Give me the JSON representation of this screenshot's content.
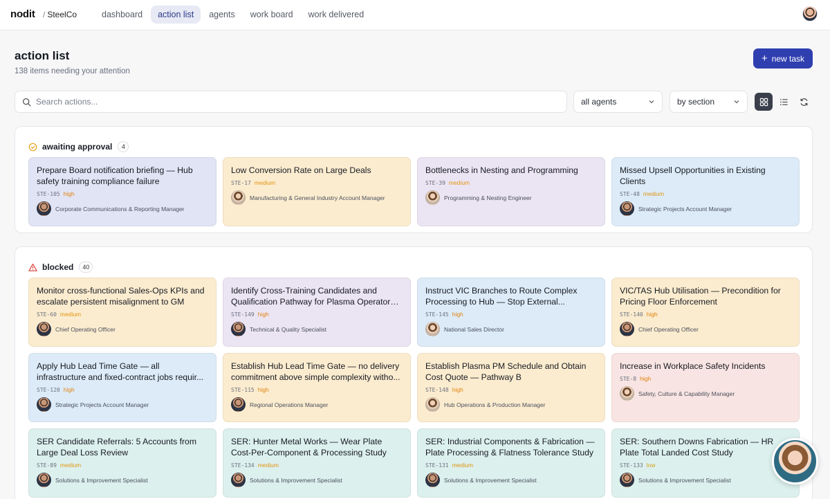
{
  "nav": {
    "brand": "nodit",
    "org": "SteelCo",
    "tabs": [
      {
        "label": "dashboard"
      },
      {
        "label": "action list"
      },
      {
        "label": "agents"
      },
      {
        "label": "work board"
      },
      {
        "label": "work delivered"
      }
    ],
    "active_tab": "action list"
  },
  "header": {
    "title": "action list",
    "subtitle": "138 items needing your attention",
    "new_task_label": "new task"
  },
  "toolbar": {
    "search_placeholder": "Search actions...",
    "agents_filter": "all agents",
    "group_by": "by section",
    "icons": [
      "grid-view-icon",
      "list-view-icon",
      "refresh-icon"
    ]
  },
  "sections": [
    {
      "title": "awaiting approval",
      "count": "4",
      "icon": "check-circle-icon",
      "cards": [
        {
          "title": "Prepare Board notification briefing — Hub safety training compliance failure",
          "id": "STE-105",
          "priority": "high",
          "owner": "Corporate Communications & Reporting Manager"
        },
        {
          "title": "Low Conversion Rate on Large Deals",
          "id": "STE-17",
          "priority": "medium",
          "owner": "Manufacturing & General Industry Account Manager"
        },
        {
          "title": "Bottlenecks in Nesting and Programming",
          "id": "STE-39",
          "priority": "medium",
          "owner": "Programming & Nesting Engineer"
        },
        {
          "title": "Missed Upsell Opportunities in Existing Clients",
          "id": "STE-48",
          "priority": "medium",
          "owner": "Strategic Projects Account Manager"
        }
      ]
    },
    {
      "title": "blocked",
      "count": "40",
      "icon": "warning-triangle-icon",
      "cards": [
        {
          "title": "Monitor cross-functional Sales-Ops KPIs and escalate persistent misalignment to GM",
          "id": "STE-60",
          "priority": "medium",
          "owner": "Chief Operating Officer"
        },
        {
          "title": "Identify Cross-Training Candidates and Qualification Pathway for Plasma Operators ...",
          "id": "STE-149",
          "priority": "high",
          "owner": "Technical & Quality Specialist"
        },
        {
          "title": "Instruct VIC Branches to Route Complex Processing to Hub — Stop External...",
          "id": "STE-145",
          "priority": "high",
          "owner": "National Sales Director"
        },
        {
          "title": "VIC/TAS Hub Utilisation — Precondition for Pricing Floor Enforcement",
          "id": "STE-140",
          "priority": "high",
          "owner": "Chief Operating Officer"
        },
        {
          "title": "Apply Hub Lead Time Gate — all infrastructure and fixed-contract jobs requir...",
          "id": "STE-120",
          "priority": "high",
          "owner": "Strategic Projects Account Manager"
        },
        {
          "title": "Establish Hub Lead Time Gate — no delivery commitment above simple complexity witho...",
          "id": "STE-115",
          "priority": "high",
          "owner": "Regional Operations Manager"
        },
        {
          "title": "Establish Plasma PM Schedule and Obtain Cost Quote — Pathway B",
          "id": "STE-148",
          "priority": "high",
          "owner": "Hub Operations & Production Manager"
        },
        {
          "title": "Increase in Workplace Safety Incidents",
          "id": "STE-8",
          "priority": "high",
          "owner": "Safety, Culture & Capability Manager"
        },
        {
          "title": "SER Candidate Referrals: 5 Accounts from Large Deal Loss Review",
          "id": "STE-89",
          "priority": "medium",
          "owner": "Solutions & Improvement Specialist"
        },
        {
          "title": "SER: Hunter Metal Works — Wear Plate Cost-Per-Component & Processing Study",
          "id": "STE-134",
          "priority": "medium",
          "owner": "Solutions & Improvement Specialist"
        },
        {
          "title": "SER: Industrial Components & Fabrication — Plate Processing & Flatness Tolerance Study",
          "id": "STE-131",
          "priority": "medium",
          "owner": "Solutions & Improvement Specialist"
        },
        {
          "title": "SER: Southern Downs Fabrication — HR Plate Total Landed Cost Study",
          "id": "STE-133",
          "priority": "low",
          "owner": "Solutions & Improvement Specialist"
        }
      ]
    }
  ],
  "colors": {
    "accent": "#2f3fb0",
    "priority_high": "#e3840f",
    "priority_medium": "#e3940f",
    "priority_low": "#d9a116"
  }
}
